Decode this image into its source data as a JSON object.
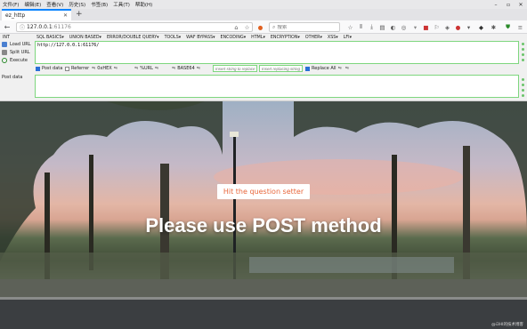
{
  "menubar": {
    "items": [
      "文件(F)",
      "编辑(E)",
      "查看(V)",
      "历史(S)",
      "书签(B)",
      "工具(T)",
      "帮助(H)"
    ]
  },
  "tab": {
    "title": "ez_http"
  },
  "navbar": {
    "url_host": "127.0.0.1",
    "url_port": ":61176",
    "search_placeholder": "搜索"
  },
  "hackbar": {
    "menu": [
      "INT",
      "SQL BASICS▾",
      "UNION BASED▾",
      "ERROR/DOUBLE QUERY▾",
      "TOOLS▾",
      "WAF BYPASS▾",
      "ENCODING▾",
      "HTML▾",
      "ENCRYPTION▾",
      "OTHER▾",
      "XSS▾",
      "LFI▾"
    ],
    "load_url": "Load URL",
    "split_url": "Split URL",
    "execute": "Execute",
    "url_value": "http://127.0.0.1:61176/",
    "options": {
      "post_data": "Post data",
      "referrer": "Referrer",
      "hex": "0xHEX",
      "url": "%URL",
      "base64": "BASE64",
      "replace_all": "Replace All"
    },
    "insert_placeholder": "Insert string to replace",
    "replacing_placeholder": "Insert replacing string",
    "post_label": "Post data"
  },
  "page": {
    "button_label": "Hit the question setter",
    "headline": "Please use POST method",
    "watermark": "@i3HI的技术博客"
  }
}
